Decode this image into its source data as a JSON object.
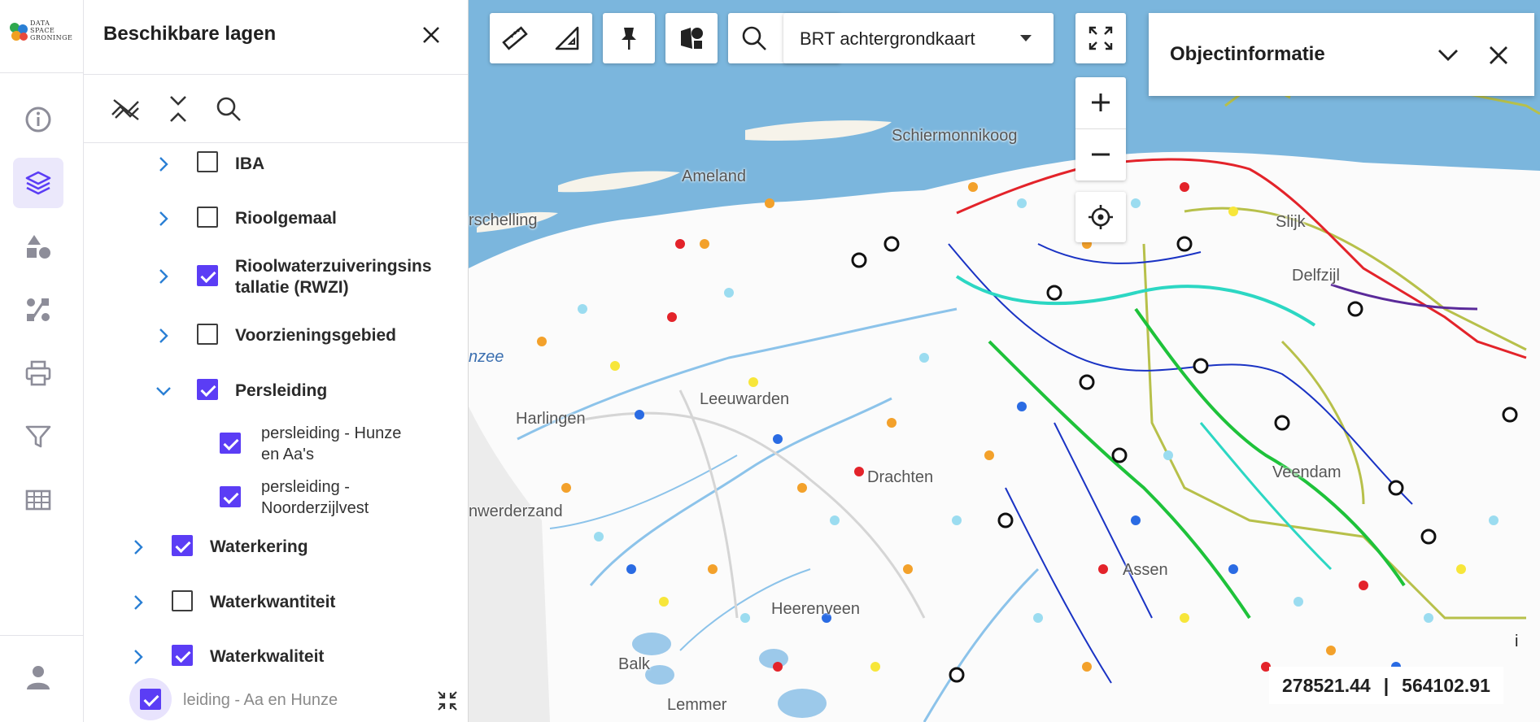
{
  "app": {
    "logo_lines": [
      "DATA",
      "SPACE",
      "GRONINGE"
    ]
  },
  "rail": {
    "items": [
      {
        "icon": "info-icon"
      },
      {
        "icon": "layers-icon",
        "active": true
      },
      {
        "icon": "shapes-icon"
      },
      {
        "icon": "route-icon"
      },
      {
        "icon": "printer-icon"
      },
      {
        "icon": "filter-icon"
      },
      {
        "icon": "table-icon"
      }
    ],
    "bottom_icon": "user-icon"
  },
  "panel": {
    "title": "Beschikbare lagen",
    "tools": [
      "hide-all-icon",
      "collapse-all-icon",
      "search-icon"
    ],
    "layers": [
      {
        "label": "IBA",
        "checked": false,
        "expanded": false
      },
      {
        "label": "Rioolgemaal",
        "checked": false,
        "expanded": false
      },
      {
        "label": "Rioolwaterzuiveringsins",
        "label2": "tallatie (RWZI)",
        "checked": true,
        "expanded": false
      },
      {
        "label": "Voorzieningsgebied",
        "checked": false,
        "expanded": false
      },
      {
        "label": "Persleiding",
        "checked": true,
        "expanded": true
      },
      {
        "label": "persleiding - Hunze",
        "label2": "en Aa's",
        "checked": true,
        "sub": true
      },
      {
        "label": "persleiding -",
        "label2": "Noorderzijlvest",
        "checked": true,
        "sub": true
      },
      {
        "label": "Waterkering",
        "checked": true,
        "expanded": false
      },
      {
        "label": "Waterkwantiteit",
        "checked": false,
        "expanded": false
      },
      {
        "label": "Waterkwaliteit",
        "checked": true,
        "expanded": false
      }
    ],
    "footer_label": "leiding - Aa en Hunze"
  },
  "map": {
    "basemap_selected": "BRT achtergrondkaart",
    "places": [
      {
        "name": "Schiermonnikoog",
        "sea": false
      },
      {
        "name": "Ameland",
        "sea": false
      },
      {
        "name": "rschelling",
        "sea": false
      },
      {
        "name": "nzee",
        "sea": true
      },
      {
        "name": "Harlingen",
        "sea": false
      },
      {
        "name": "Leeuwarden",
        "sea": false
      },
      {
        "name": "Drachten",
        "sea": false
      },
      {
        "name": "nwerderzand",
        "sea": false
      },
      {
        "name": "Heerenveen",
        "sea": false
      },
      {
        "name": "Balk",
        "sea": false
      },
      {
        "name": "Lemmer",
        "sea": false
      },
      {
        "name": "Veendam",
        "sea": false
      },
      {
        "name": "Assen",
        "sea": false
      },
      {
        "name": "Delfzijl",
        "sea": false
      },
      {
        "name": "Slijk",
        "sea": false
      }
    ],
    "info_panel_title": "Objectinformatie",
    "coord_x": "278521.44",
    "coord_sep": "|",
    "coord_y": "564102.91",
    "info_marker": "i",
    "colors": {
      "accent": "#5b3df5",
      "water": "#7bb6dd",
      "land": "#ffffff"
    }
  }
}
